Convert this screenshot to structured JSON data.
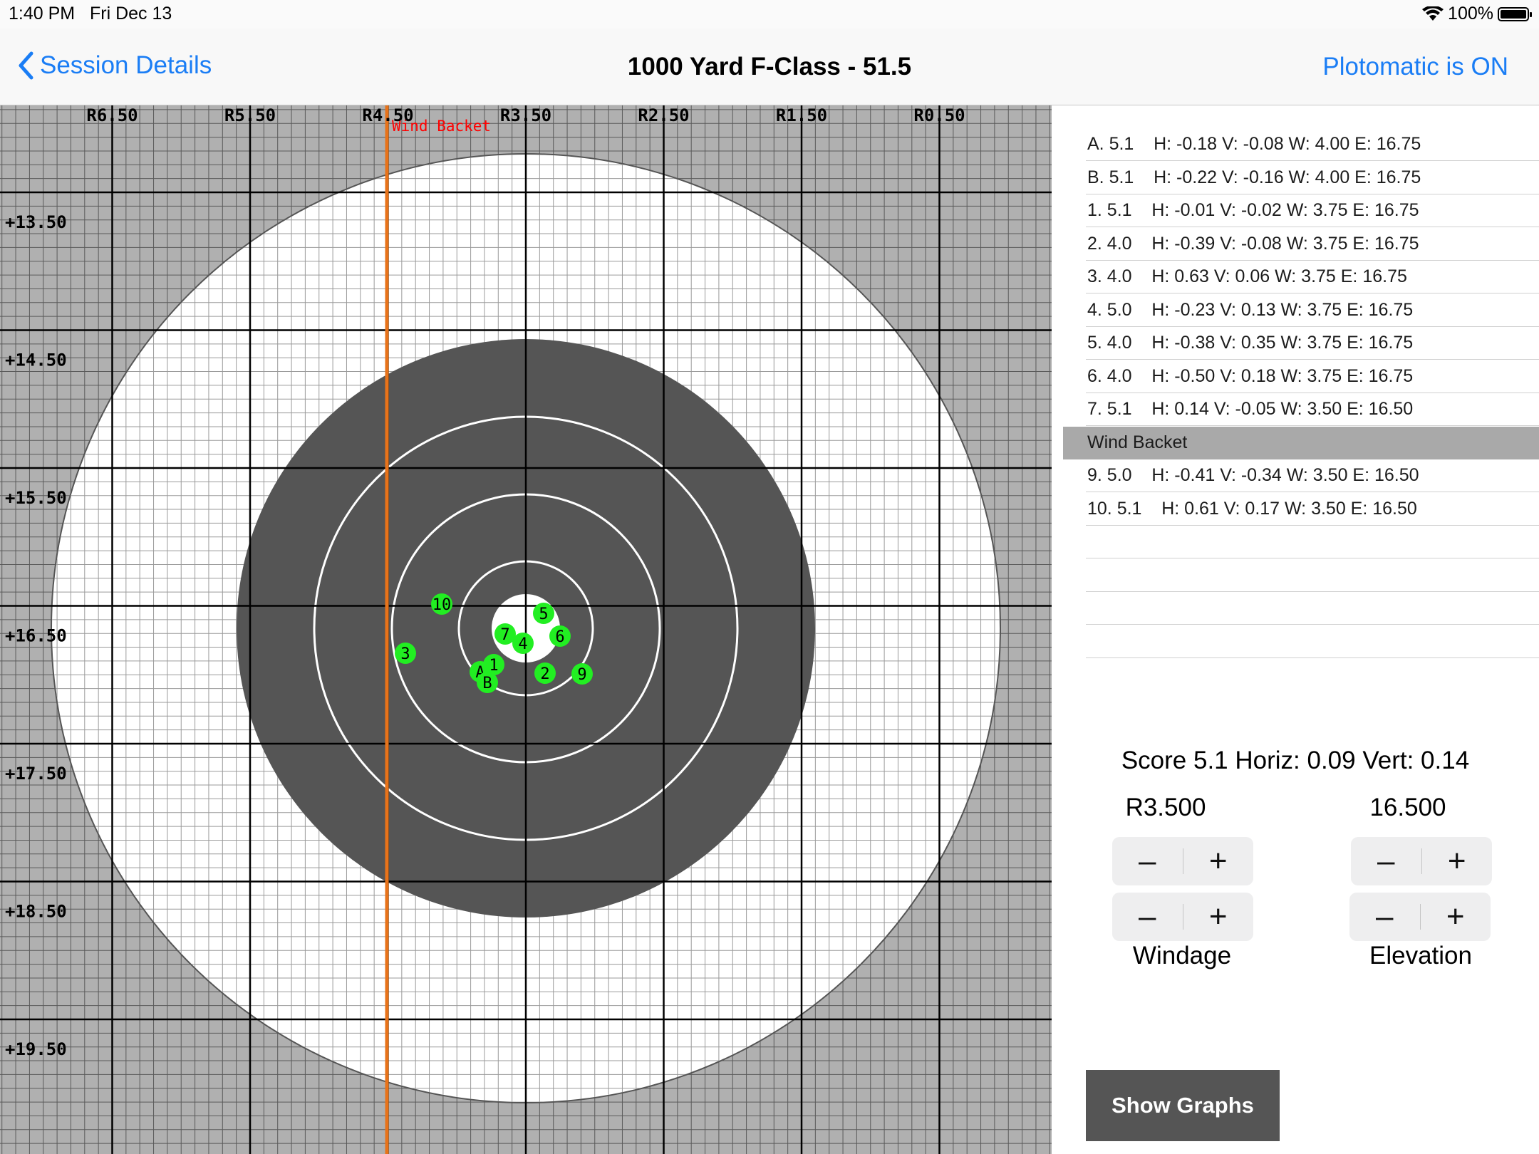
{
  "status": {
    "time": "1:40 PM",
    "date": "Fri Dec 13",
    "battery": "100%",
    "battery_level": 1.0
  },
  "nav": {
    "back_label": "Session Details",
    "title": "1000 Yard F-Class - 51.5",
    "right_label": "Plotomatic is ON"
  },
  "target": {
    "top_labels": [
      "R6.50",
      "R5.50",
      "R4.50",
      "R3.50",
      "R2.50",
      "R1.50",
      "R0.50"
    ],
    "left_labels": [
      "+13.50",
      "+14.50",
      "+15.50",
      "+16.50",
      "+17.50",
      "+18.50",
      "+19.50"
    ],
    "wind_label": "Wind Backet",
    "shots": [
      {
        "label": "10"
      },
      {
        "label": "5"
      },
      {
        "label": "7"
      },
      {
        "label": "4"
      },
      {
        "label": "6"
      },
      {
        "label": "3"
      },
      {
        "label": "A"
      },
      {
        "label": "1"
      },
      {
        "label": "B"
      },
      {
        "label": "2"
      },
      {
        "label": "9"
      }
    ],
    "colors": {
      "shot": "#22ee22",
      "black_ring": "#555555",
      "wind_line": "#e8731a",
      "wind_text": "#ff0000"
    }
  },
  "shot_list": [
    {
      "text": "A. 5.1    H: -0.18 V: -0.08 W: 4.00 E: 16.75"
    },
    {
      "text": "B. 5.1    H: -0.22 V: -0.16 W: 4.00 E: 16.75"
    },
    {
      "text": "1. 5.1    H: -0.01 V: -0.02 W: 3.75 E: 16.75"
    },
    {
      "text": "2. 4.0    H: -0.39 V: -0.08 W: 3.75 E: 16.75"
    },
    {
      "text": "3. 4.0    H: 0.63 V: 0.06 W: 3.75 E: 16.75"
    },
    {
      "text": "4. 5.0    H: -0.23 V: 0.13 W: 3.75 E: 16.75"
    },
    {
      "text": "5. 4.0    H: -0.38 V: 0.35 W: 3.75 E: 16.75"
    },
    {
      "text": "6. 4.0    H: -0.50 V: 0.18 W: 3.75 E: 16.75"
    },
    {
      "text": "7. 5.1    H: 0.14 V: -0.05 W: 3.50 E: 16.50"
    },
    {
      "text": "Wind Backet",
      "highlight": true
    },
    {
      "text": "9. 5.0    H: -0.41 V: -0.34 W: 3.50 E: 16.50"
    },
    {
      "text": "10. 5.1    H: 0.61 V: 0.17 W: 3.50 E: 16.50"
    },
    {
      "text": ""
    },
    {
      "text": ""
    },
    {
      "text": ""
    },
    {
      "text": ""
    }
  ],
  "score": {
    "line": "Score 5.1  Horiz: 0.09 Vert: 0.14",
    "windage_value": "R3.500",
    "elevation_value": "16.500"
  },
  "controls": {
    "minus": "–",
    "plus": "+",
    "windage_label": "Windage",
    "elevation_label": "Elevation"
  },
  "show_graphs": "Show Graphs"
}
